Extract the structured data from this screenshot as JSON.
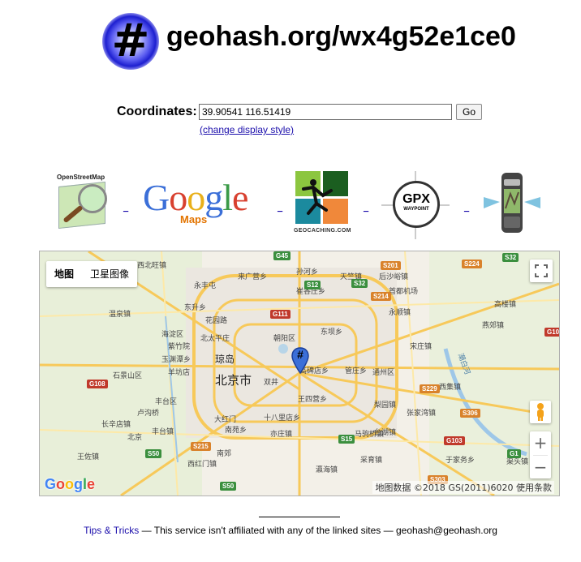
{
  "header": {
    "logo_symbol": "#",
    "title": "geohash.org/wx4g52e1ce0"
  },
  "coords": {
    "label": "Coordinates:",
    "value": "39.90541 116.51419",
    "go_label": "Go",
    "change_style_label": "(change display style)"
  },
  "services": {
    "osm_title": "OpenStreetMap",
    "google_word": [
      "G",
      "o",
      "o",
      "g",
      "l",
      "e"
    ],
    "google_maps_label": "Maps",
    "geocaching_label": "GEOCACHING.COM",
    "gpx_label": "GPX",
    "gpx_sub": "WAYPOINT",
    "separator": "_"
  },
  "map": {
    "type_map": "地图",
    "type_satellite": "卫星图像",
    "attribution": "地图数据 ©2018 GS(2011)6020   使用条款",
    "google_letters": [
      "G",
      "o",
      "o",
      "g",
      "l",
      "e"
    ],
    "zoom_in": "+",
    "zoom_out": "−",
    "marker_symbol": "#",
    "labels": [
      {
        "text": "北京市",
        "big": true
      },
      {
        "text": "琼岛",
        "big": true
      },
      {
        "text": "西北旺镇"
      },
      {
        "text": "永丰屯"
      },
      {
        "text": "温泉镇"
      },
      {
        "text": "东升乡"
      },
      {
        "text": "花园路"
      },
      {
        "text": "海淀区"
      },
      {
        "text": "北太平庄"
      },
      {
        "text": "紫竹院"
      },
      {
        "text": "玉渊潭乡"
      },
      {
        "text": "羊坊店"
      },
      {
        "text": "石景山区"
      },
      {
        "text": "卢沟桥"
      },
      {
        "text": "丰台区"
      },
      {
        "text": "丰台镇"
      },
      {
        "text": "大红门"
      },
      {
        "text": "南苑乡"
      },
      {
        "text": "西红门镇"
      },
      {
        "text": "亦庄镇"
      },
      {
        "text": "朝阳区"
      },
      {
        "text": "双井"
      },
      {
        "text": "王四营乡"
      },
      {
        "text": "十八里店乡"
      },
      {
        "text": "高碑店乡"
      },
      {
        "text": "管庄乡"
      },
      {
        "text": "通州区"
      },
      {
        "text": "梨园镇"
      },
      {
        "text": "张家湾镇"
      },
      {
        "text": "马驹桥镇"
      },
      {
        "text": "宋庄镇"
      },
      {
        "text": "潮白河"
      },
      {
        "text": "来广营乡"
      },
      {
        "text": "崔各庄乡"
      },
      {
        "text": "东坝乡"
      },
      {
        "text": "孙河乡"
      },
      {
        "text": "天竺镇"
      },
      {
        "text": "首都机场"
      },
      {
        "text": "后沙峪镇"
      },
      {
        "text": "永顺镇"
      },
      {
        "text": "台湖镇"
      },
      {
        "text": "西集镇"
      },
      {
        "text": "燕郊镇"
      },
      {
        "text": "高楼镇"
      },
      {
        "text": "于家务乡"
      },
      {
        "text": "采育镇"
      },
      {
        "text": "渠头镇"
      },
      {
        "text": "瀛海镇"
      },
      {
        "text": "南郊"
      },
      {
        "text": "长辛店镇"
      },
      {
        "text": "王佐镇"
      },
      {
        "text": "北京"
      }
    ],
    "shields": [
      {
        "text": "G45",
        "color": "#3b8f3e"
      },
      {
        "text": "S12",
        "color": "#3b8f3e"
      },
      {
        "text": "S32",
        "color": "#3b8f3e"
      },
      {
        "text": "S201",
        "color": "#d9822b"
      },
      {
        "text": "S224",
        "color": "#d9822b"
      },
      {
        "text": "S32",
        "color": "#3b8f3e"
      },
      {
        "text": "G111",
        "color": "#c0392b"
      },
      {
        "text": "S214",
        "color": "#d9822b"
      },
      {
        "text": "G108",
        "color": "#c0392b"
      },
      {
        "text": "S229",
        "color": "#d9822b"
      },
      {
        "text": "S306",
        "color": "#d9822b"
      },
      {
        "text": "S215",
        "color": "#d9822b"
      },
      {
        "text": "S50",
        "color": "#3b8f3e"
      },
      {
        "text": "S15",
        "color": "#3b8f3e"
      },
      {
        "text": "G103",
        "color": "#c0392b"
      },
      {
        "text": "G1",
        "color": "#3b8f3e"
      },
      {
        "text": "S303",
        "color": "#d9822b"
      },
      {
        "text": "S50",
        "color": "#3b8f3e"
      },
      {
        "text": "G10",
        "color": "#c0392b"
      }
    ]
  },
  "footer": {
    "tips_label": "Tips & Tricks",
    "disclaimer": " — This service isn't affiliated with any of the linked sites — geohash@geohash.org"
  }
}
